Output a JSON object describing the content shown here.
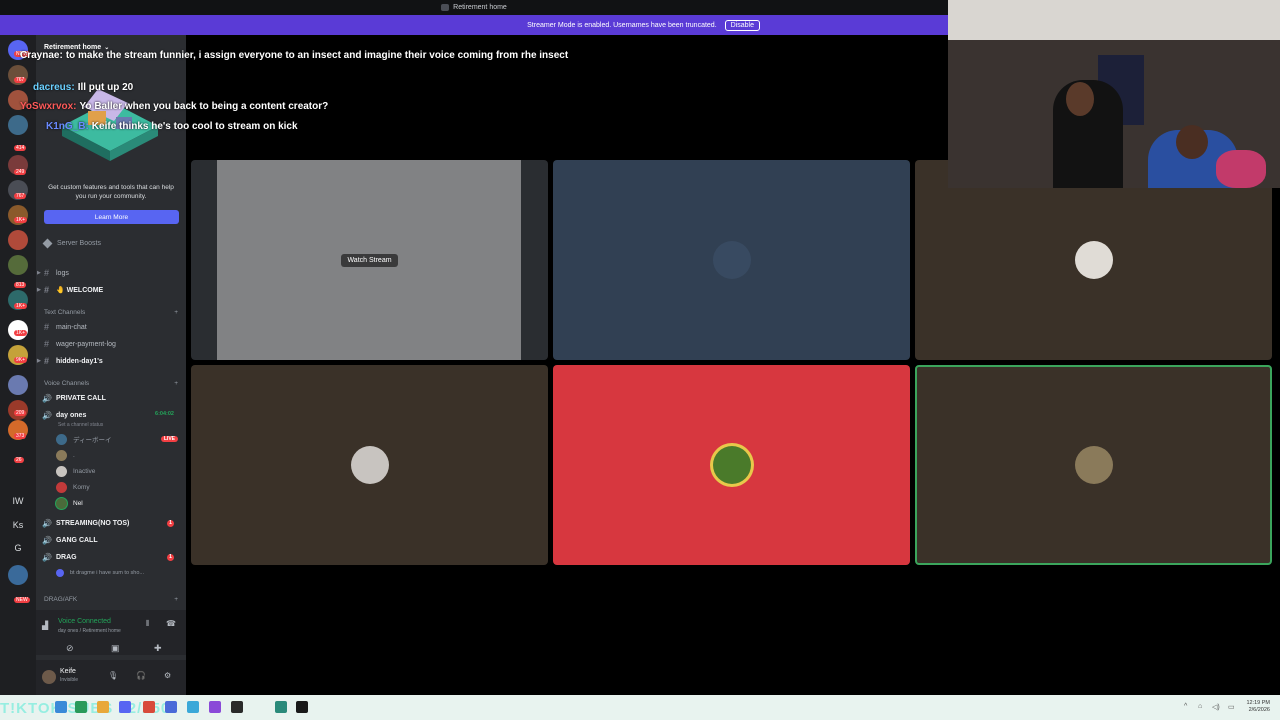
{
  "window": {
    "title": "Retirement home"
  },
  "streamer_mode": {
    "message": "Streamer Mode is enabled. Usernames have been truncated.",
    "disable_label": "Disable"
  },
  "rail": {
    "badges": [
      "NEW",
      "767",
      "414",
      "249",
      "767",
      "1K+",
      "813",
      "1K+",
      "1K+",
      "9K+",
      "128",
      "209",
      "373",
      "26"
    ],
    "text_items": [
      "IW",
      "Ks",
      "G"
    ],
    "bottom_badge": "NEW"
  },
  "sidebar": {
    "server_name": "Retirement home",
    "promo_text": "Get custom features and tools that can help you run your community.",
    "learn_more": "Learn More",
    "server_boosts": "Server Boosts",
    "channels": {
      "logs": "logs",
      "welcome": "🤚 WELCOME",
      "text_category": "Text Channels",
      "main_chat": "main-chat",
      "wager_log": "wager-payment-log",
      "hidden": "hidden-day1's",
      "voice_category": "Voice Channels",
      "private_call": "PRIVATE CALL",
      "day_ones": "day ones",
      "day_ones_time": "6:04:02",
      "set_status": "Set a channel status",
      "streaming": "STREAMING(NO TOS)",
      "gang_call": "GANG CALL",
      "drag": "DRAG",
      "drag_member": "bt dragme i have sum to sho...",
      "drag_afk": "DRAG/AFK"
    },
    "members": [
      {
        "name": "ディーボーイ",
        "live": "LIVE"
      },
      {
        "name": ".",
        "live": ""
      },
      {
        "name": "Inactive",
        "live": ""
      },
      {
        "name": "Komy",
        "live": ""
      },
      {
        "name": "Nel",
        "live": ""
      }
    ],
    "voice_connected": {
      "label": "Voice Connected",
      "sub": "day ones / Retirement home"
    },
    "user": {
      "name": "Keife",
      "status": "Invisible"
    },
    "badge_counts": {
      "streaming": "1",
      "drag": "1"
    }
  },
  "chat_overlay": [
    {
      "user": "Craynae:",
      "text": "to make the stream funnier, i assign everyone to an insect and imagine their voice coming from rhe insect"
    },
    {
      "user": "dacreus:",
      "text": "Ill put up 20"
    },
    {
      "user": "YoSwxrvox:",
      "text": "Yo Baller when you back to being a content creator?"
    },
    {
      "user": "K1nG_B:",
      "text": "Keife thinks he's too cool to stream on kick"
    }
  ],
  "grid": {
    "watch_label": "Watch Stream",
    "tile_colors": [
      "#2a2d31",
      "#314053",
      "#3a3128",
      "#3a3128",
      "#d7373f",
      "#3a3128"
    ]
  },
  "taskbar": {
    "time": "12:19 PM",
    "date": "2/6/2026",
    "ghost_text": "T!KTOK SUBS 22/250"
  }
}
